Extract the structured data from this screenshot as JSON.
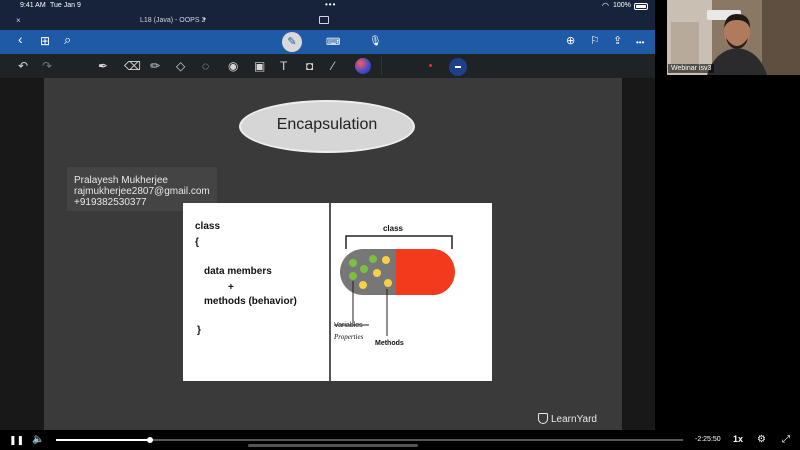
{
  "status_bar": {
    "time": "9:41 AM",
    "date": "Tue Jan 9",
    "dots": "•••",
    "battery": "100%"
  },
  "title_bar": {
    "doc_title": "L18 (Java) - OOPS 2",
    "close": "×"
  },
  "toolbar": {
    "back": "‹",
    "grid": "⊞",
    "search": "⌕",
    "more": "•••"
  },
  "document": {
    "heading": "Encapsulation",
    "watermark": {
      "name": "Pralayesh Mukherjee",
      "email": "rajmukherjee2807@gmail.com",
      "phone": "+919382530377"
    },
    "slide": {
      "code_lines": [
        "class",
        "{",
        "data members",
        "+",
        "methods (behavior)",
        "}"
      ],
      "capsule_label": "class",
      "label_variables": "Variables",
      "label_properties": "Properties",
      "label_methods": "Methods"
    },
    "brand": "LearnYard"
  },
  "webcam": {
    "label": "Webinar isv3"
  },
  "player": {
    "progress": 0.15,
    "time_remaining": "-2:25:50",
    "speed": "1x"
  }
}
